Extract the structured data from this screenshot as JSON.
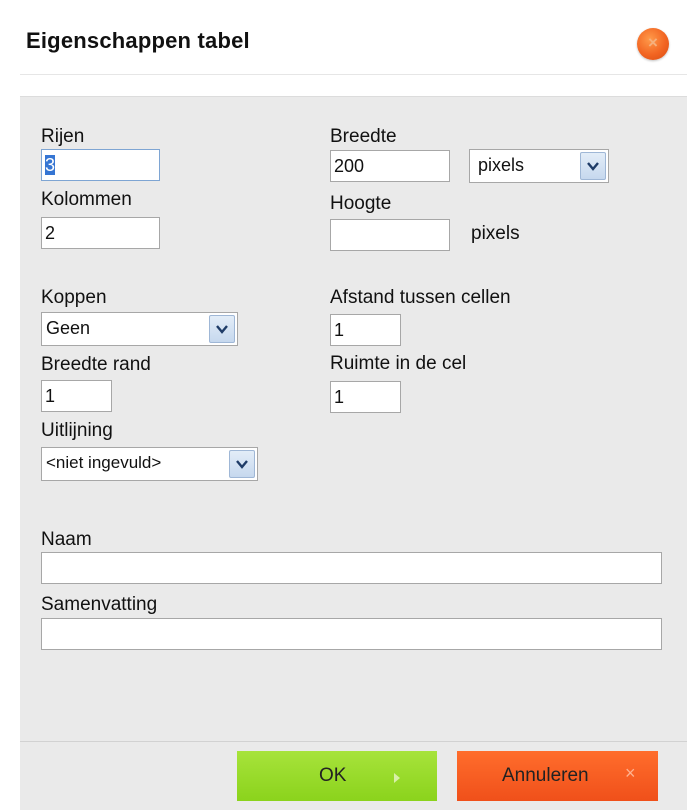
{
  "dialog": {
    "title": "Eigenschappen tabel",
    "close_glyph": "×"
  },
  "fields": {
    "rows": {
      "label": "Rijen",
      "value": "3"
    },
    "columns": {
      "label": "Kolommen",
      "value": "2"
    },
    "width": {
      "label": "Breedte",
      "value": "200",
      "unit_selected": "pixels"
    },
    "height": {
      "label": "Hoogte",
      "value": "",
      "unit_text": "pixels"
    },
    "headers": {
      "label": "Koppen",
      "selected": "Geen"
    },
    "border_width": {
      "label": "Breedte rand",
      "value": "1"
    },
    "alignment": {
      "label": "Uitlijning",
      "selected": "<niet ingevuld>"
    },
    "cell_spacing": {
      "label": "Afstand tussen cellen",
      "value": "1"
    },
    "cell_padding": {
      "label": "Ruimte in de cel",
      "value": "1"
    },
    "name": {
      "label": "Naam",
      "value": ""
    },
    "summary": {
      "label": "Samenvatting",
      "value": ""
    }
  },
  "footer": {
    "ok_label": "OK",
    "cancel_label": "Annuleren",
    "cancel_glyph": "×"
  },
  "colors": {
    "ok_button": "#8bd31c",
    "cancel_button": "#f0501a",
    "close_button": "#f26522",
    "panel_background": "#eaeaea",
    "selection": "#3575d3"
  },
  "icons": {
    "close": "close-icon",
    "dropdown": "chevron-down-icon",
    "ok": "play-arrow-icon",
    "cancel": "cross-icon"
  }
}
